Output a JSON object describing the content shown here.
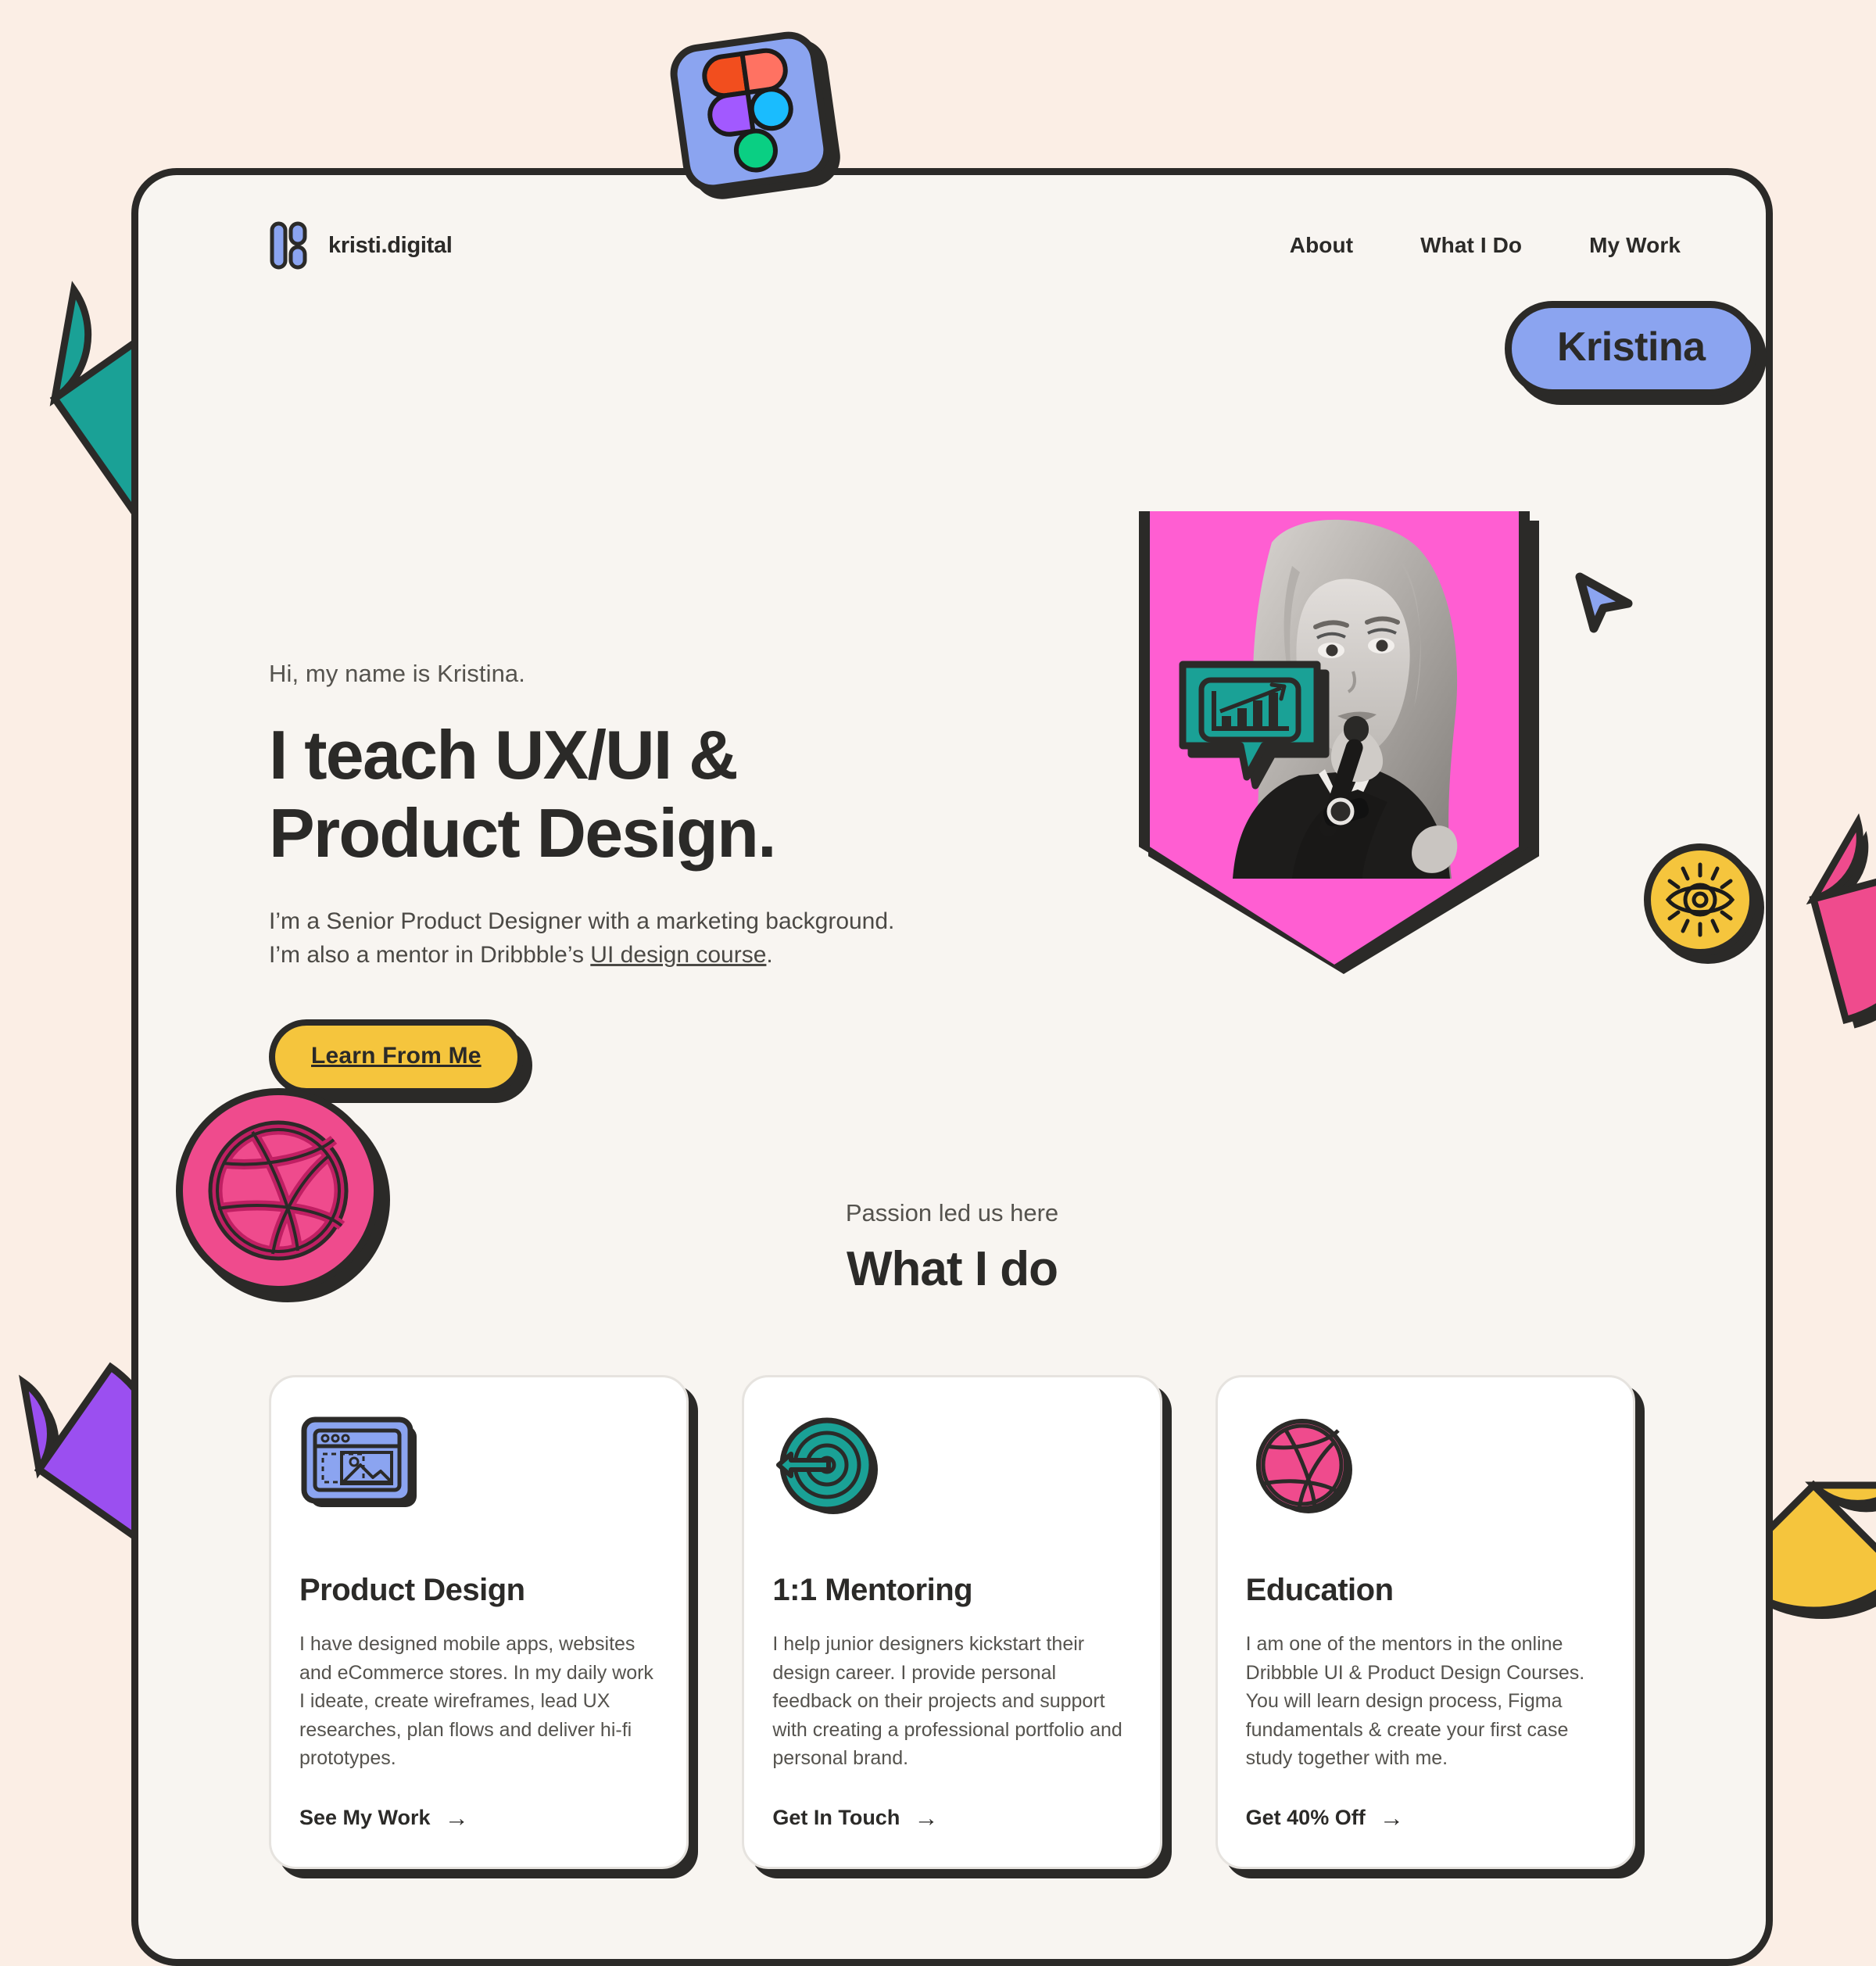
{
  "brand": {
    "name": "kristi.digital",
    "logo_icon": "kristi-logo-icon",
    "logo_color": "#8ba4f0"
  },
  "nav": {
    "items": [
      {
        "label": "About"
      },
      {
        "label": "What I Do"
      },
      {
        "label": "My Work"
      }
    ]
  },
  "hero": {
    "greeting": "Hi, my name is Kristina.",
    "title_line1": "I teach UX/UI &",
    "title_line2": "Product Design.",
    "desc_line1": "I’m a Senior Product Designer with a marketing background.",
    "desc_line2_before": "I’m also a mentor in Dribbble’s ",
    "desc_link": "UI design course",
    "desc_line2_after": ".",
    "cta_label": "Learn From Me",
    "cta_color": "#f5c53d"
  },
  "badges": {
    "figma": {
      "icon": "figma-icon",
      "bg": "#8ba4f0"
    },
    "name_pill": {
      "label": "Kristina",
      "bg": "#8ba4f0"
    },
    "chart_bubble": {
      "icon": "chart-speech-bubble-icon",
      "bg": "#1aa196"
    },
    "eye": {
      "icon": "eye-icon",
      "bg": "#f5c53d"
    },
    "dribbble": {
      "icon": "dribbble-icon",
      "bg": "#ef4b8d"
    },
    "cursor": {
      "icon": "cursor-arrow-icon",
      "bg": "#8ba4f0"
    }
  },
  "portrait": {
    "alt": "Kristina speaking into a microphone",
    "backdrop_color": "#ff5ed2"
  },
  "services": {
    "eyebrow": "Passion led us here",
    "title": "What I do",
    "cards": [
      {
        "icon": "browser-wireframe-icon",
        "icon_color": "#8ba4f0",
        "title": "Product Design",
        "text": "I have designed mobile apps, websites and eCommerce stores. In my daily work I ideate, create wireframes, lead UX researches, plan flows and deliver hi-fi prototypes.",
        "link_label": "See My Work",
        "link_arrow": "→"
      },
      {
        "icon": "target-arrow-icon",
        "icon_color": "#1aa196",
        "title": "1:1 Mentoring",
        "text": "I help junior designers kickstart their design career. I provide personal feedback on their projects and support with creating a professional portfolio and personal brand.",
        "link_label": "Get In Touch",
        "link_arrow": "→"
      },
      {
        "icon": "dribbble-icon",
        "icon_color": "#ef4b8d",
        "title": "Education",
        "text": "I am one of the mentors in the online Dribbble UI & Product Design Courses. You will learn design process, Figma fundamentals & create your first case study together with me.",
        "link_label": "Get 40% Off",
        "link_arrow": "→"
      }
    ]
  },
  "decorations": {
    "teal_wedge": {
      "color": "#1aa196"
    },
    "purple_wedge": {
      "color": "#9b4ff0"
    },
    "pink_wedge": {
      "color": "#ef4b8d"
    },
    "yellow_wedge": {
      "color": "#f5c53d"
    }
  },
  "theme": {
    "canvas_bg": "#fbeee5",
    "panel_bg": "#f8f5f1",
    "ink": "#2b2a28"
  }
}
